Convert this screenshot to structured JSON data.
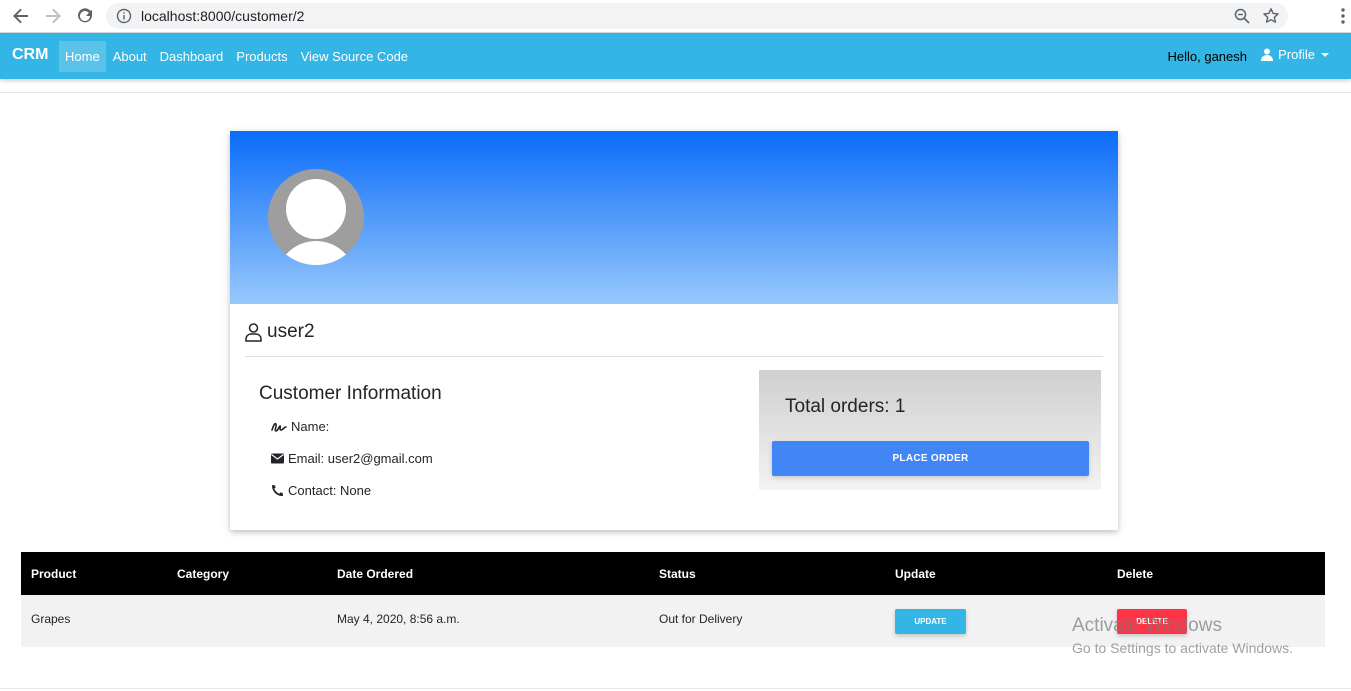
{
  "browser": {
    "url": "localhost:8000/customer/2"
  },
  "navbar": {
    "brand": "CRM",
    "items": [
      {
        "label": "Home",
        "active": true
      },
      {
        "label": "About"
      },
      {
        "label": "Dashboard"
      },
      {
        "label": "Products"
      },
      {
        "label": "View Source Code"
      }
    ],
    "greeting": "Hello, ganesh",
    "profile_label": "Profile"
  },
  "customer": {
    "username": "user2",
    "info_title": "Customer Information",
    "name_label": "Name:",
    "email_label": "Email: user2@gmail.com",
    "contact_label": "Contact: None",
    "total_orders_label": "Total orders: 1",
    "place_order_label": "PLACE ORDER"
  },
  "orders": {
    "headers": [
      "Product",
      "Category",
      "Date Ordered",
      "Status",
      "Update",
      "Delete"
    ],
    "rows": [
      {
        "product": "Grapes",
        "category": "",
        "date": "May 4, 2020, 8:56 a.m.",
        "status": "Out for Delivery",
        "update_label": "UPDATE",
        "delete_label": "DELETE"
      }
    ]
  },
  "watermark": {
    "title": "Activate Windows",
    "subtitle": "Go to Settings to activate Windows."
  },
  "colors": {
    "navbar": "#33b5e5",
    "primary": "#4285f4",
    "danger": "#ff3547"
  }
}
